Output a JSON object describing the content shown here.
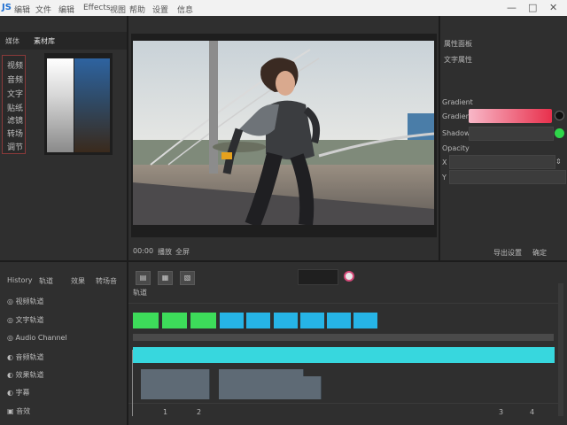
{
  "titlebar": {
    "logo": "JS",
    "title": "编辑",
    "menu": [
      "文件",
      "编辑",
      "Effects",
      "视图",
      "帮助",
      "设置",
      "信息"
    ],
    "minimize": "—",
    "maximize": "□",
    "close": "✕"
  },
  "left_panel": {
    "tab1": "媒体",
    "tab2": "素材库",
    "tools": [
      "视频",
      "音频",
      "文字",
      "贴纸",
      "滤镜",
      "转场",
      "调节"
    ]
  },
  "preview": {
    "time_label": "00:00",
    "ctrl1": "播放",
    "ctrl2": "全屏"
  },
  "props": {
    "header": "属性面板",
    "sub": "文字属性",
    "section": "Gradient",
    "color_label": "Gradient",
    "color2_label": "Shadow",
    "opacity_label": "Opacity",
    "x_label": "X",
    "y_label": "Y",
    "footer_left": "导出设置",
    "footer_right": "确定",
    "gradient_from": "#f8b8c8",
    "gradient_to": "#e8304c",
    "accent_green": "#2fd64a"
  },
  "timeline": {
    "tab1": "History",
    "tab2": "轨道",
    "tab3": "效果",
    "tab4": "转场音",
    "ruler_label": "轨道",
    "tracks": [
      "视频轨道",
      "文字轨道",
      "Audio Channel",
      "音频轨道",
      "效果轨道",
      "字幕",
      "音效"
    ],
    "bottom_marks": [
      "1",
      "2",
      "3",
      "4"
    ]
  }
}
